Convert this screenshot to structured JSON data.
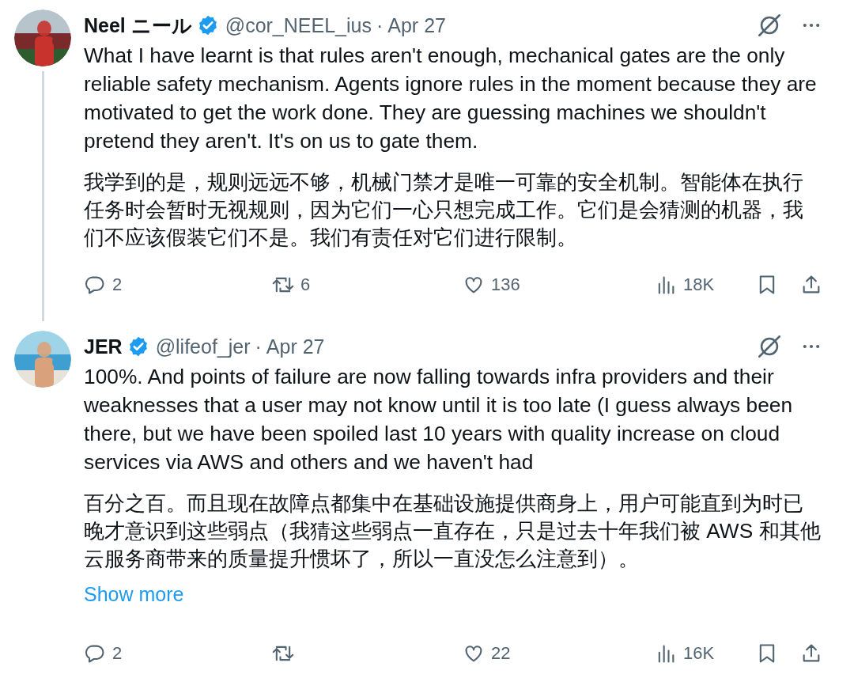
{
  "tweets": [
    {
      "name": "Neel ニール",
      "verified": true,
      "handle": "@cor_NEEL_ius",
      "separator": "·",
      "date": "Apr 27",
      "thread_line": true,
      "paragraphs": [
        "What I have learnt is that rules aren't enough, mechanical gates are the only reliable safety mechanism. Agents ignore rules in the moment because they are motivated to get the work done. They are guessing machines we shouldn't pretend they aren't. It's on us to gate them.",
        "我学到的是，规则远远不够，机械门禁才是唯一可靠的安全机制。智能体在执行任务时会暂时无视规则，因为它们一心只想完成工作。它们是会猜测的机器，我们不应该假装它们不是。我们有责任对它们进行限制。"
      ],
      "actions": {
        "replies": "2",
        "reposts": "6",
        "likes": "136",
        "views": "18K"
      }
    },
    {
      "name": "JER",
      "verified": true,
      "handle": "@lifeof_jer",
      "separator": "·",
      "date": "Apr 27",
      "thread_line": false,
      "paragraphs": [
        "100%. And points of failure are now falling towards infra providers and their weaknesses that a user may not know until it is too late (I guess always been there, but we have been spoiled last 10 years with quality increase on cloud services via AWS and others and we haven't had",
        "百分之百。而且现在故障点都集中在基础设施提供商身上，用户可能直到为时已晚才意识到这些弱点（我猜这些弱点一直存在，只是过去十年我们被 AWS 和其他云服务商带来的质量提升惯坏了，所以一直没怎么注意到）。"
      ],
      "show_more": "Show more",
      "actions": {
        "replies": "2",
        "likes": "22",
        "views": "16K"
      }
    }
  ]
}
